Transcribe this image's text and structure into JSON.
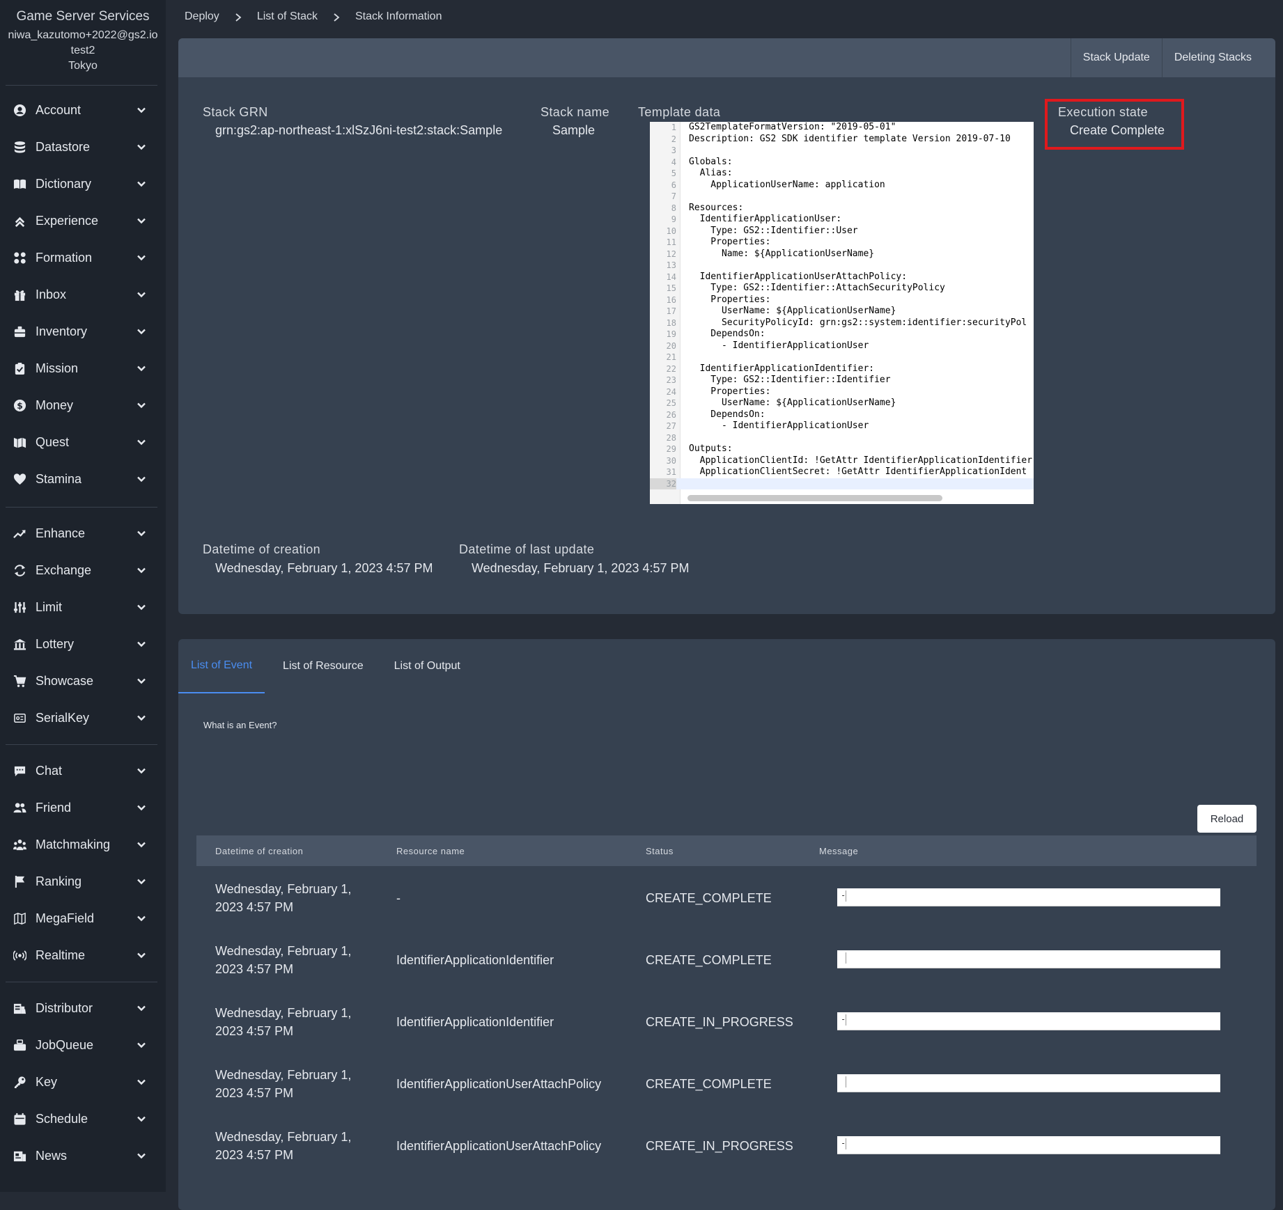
{
  "sidebar": {
    "brand": "Game Server Services",
    "account_email": "niwa_kazutomo+2022@gs2.io",
    "project": "test2",
    "region": "Tokyo",
    "groups": [
      [
        {
          "label": "Account",
          "icon": "account-icon"
        },
        {
          "label": "Datastore",
          "icon": "datastore-icon"
        },
        {
          "label": "Dictionary",
          "icon": "dictionary-icon"
        },
        {
          "label": "Experience",
          "icon": "experience-icon"
        },
        {
          "label": "Formation",
          "icon": "formation-icon"
        },
        {
          "label": "Inbox",
          "icon": "inbox-icon"
        },
        {
          "label": "Inventory",
          "icon": "inventory-icon"
        },
        {
          "label": "Mission",
          "icon": "mission-icon"
        },
        {
          "label": "Money",
          "icon": "money-icon"
        },
        {
          "label": "Quest",
          "icon": "quest-icon"
        },
        {
          "label": "Stamina",
          "icon": "stamina-icon"
        }
      ],
      [
        {
          "label": "Enhance",
          "icon": "enhance-icon"
        },
        {
          "label": "Exchange",
          "icon": "exchange-icon"
        },
        {
          "label": "Limit",
          "icon": "limit-icon"
        },
        {
          "label": "Lottery",
          "icon": "lottery-icon"
        },
        {
          "label": "Showcase",
          "icon": "showcase-icon"
        },
        {
          "label": "SerialKey",
          "icon": "serialkey-icon"
        }
      ],
      [
        {
          "label": "Chat",
          "icon": "chat-icon"
        },
        {
          "label": "Friend",
          "icon": "friend-icon"
        },
        {
          "label": "Matchmaking",
          "icon": "matchmaking-icon"
        },
        {
          "label": "Ranking",
          "icon": "ranking-icon"
        },
        {
          "label": "MegaField",
          "icon": "megafield-icon"
        },
        {
          "label": "Realtime",
          "icon": "realtime-icon"
        }
      ],
      [
        {
          "label": "Distributor",
          "icon": "distributor-icon"
        },
        {
          "label": "JobQueue",
          "icon": "jobqueue-icon"
        },
        {
          "label": "Key",
          "icon": "key-icon"
        },
        {
          "label": "Schedule",
          "icon": "schedule-icon"
        },
        {
          "label": "News",
          "icon": "news-icon"
        }
      ]
    ]
  },
  "breadcrumb": [
    "Deploy",
    "List of Stack",
    "Stack Information"
  ],
  "stack": {
    "actions": {
      "update": "Stack Update",
      "delete": "Deleting Stacks"
    },
    "grn_label": "Stack GRN",
    "grn_value": "grn:gs2:ap-northeast-1:xlSzJ6ni-test2:stack:Sample",
    "name_label": "Stack name",
    "name_value": "Sample",
    "template_label": "Template data",
    "exec_label": "Execution state",
    "exec_value": "Create Complete",
    "created_label": "Datetime of creation",
    "created_value": "Wednesday, February 1, 2023 4:57 PM",
    "updated_label": "Datetime of last update",
    "updated_value": "Wednesday, February 1, 2023 4:57 PM",
    "highlight_color": "#e0191d"
  },
  "template_lines": [
    "GS2TemplateFormatVersion: \"2019-05-01\"",
    "Description: GS2 SDK identifier template Version 2019-07-10",
    "",
    "Globals:",
    "  Alias:",
    "    ApplicationUserName: application",
    "",
    "Resources:",
    "  IdentifierApplicationUser:",
    "    Type: GS2::Identifier::User",
    "    Properties:",
    "      Name: ${ApplicationUserName}",
    "",
    "  IdentifierApplicationUserAttachPolicy:",
    "    Type: GS2::Identifier::AttachSecurityPolicy",
    "    Properties:",
    "      UserName: ${ApplicationUserName}",
    "      SecurityPolicyId: grn:gs2::system:identifier:securityPol",
    "    DependsOn:",
    "      - IdentifierApplicationUser",
    "",
    "  IdentifierApplicationIdentifier:",
    "    Type: GS2::Identifier::Identifier",
    "    Properties:",
    "      UserName: ${ApplicationUserName}",
    "    DependsOn:",
    "      - IdentifierApplicationUser",
    "",
    "Outputs:",
    "  ApplicationClientId: !GetAttr IdentifierApplicationIdentifier",
    "  ApplicationClientSecret: !GetAttr IdentifierApplicationIdent",
    ""
  ],
  "events": {
    "tabs": [
      "List of Event",
      "List of Resource",
      "List of Output"
    ],
    "help_link": "What is an Event?",
    "reload": "Reload",
    "columns": [
      "Datetime of creation",
      "Resource name",
      "Status",
      "Message"
    ],
    "rows": [
      {
        "date1": "Wednesday, February 1,",
        "date2": "2023 4:57 PM",
        "resource": "-",
        "status": "CREATE_COMPLETE",
        "message": "-"
      },
      {
        "date1": "Wednesday, February 1,",
        "date2": "2023 4:57 PM",
        "resource": "IdentifierApplicationIdentifier",
        "status": "CREATE_COMPLETE",
        "message": ""
      },
      {
        "date1": "Wednesday, February 1,",
        "date2": "2023 4:57 PM",
        "resource": "IdentifierApplicationIdentifier",
        "status": "CREATE_IN_PROGRESS",
        "message": "-"
      },
      {
        "date1": "Wednesday, February 1,",
        "date2": "2023 4:57 PM",
        "resource": "IdentifierApplicationUserAttachPolicy",
        "status": "CREATE_COMPLETE",
        "message": ""
      },
      {
        "date1": "Wednesday, February 1,",
        "date2": "2023 4:57 PM",
        "resource": "IdentifierApplicationUserAttachPolicy",
        "status": "CREATE_IN_PROGRESS",
        "message": "-"
      }
    ]
  }
}
